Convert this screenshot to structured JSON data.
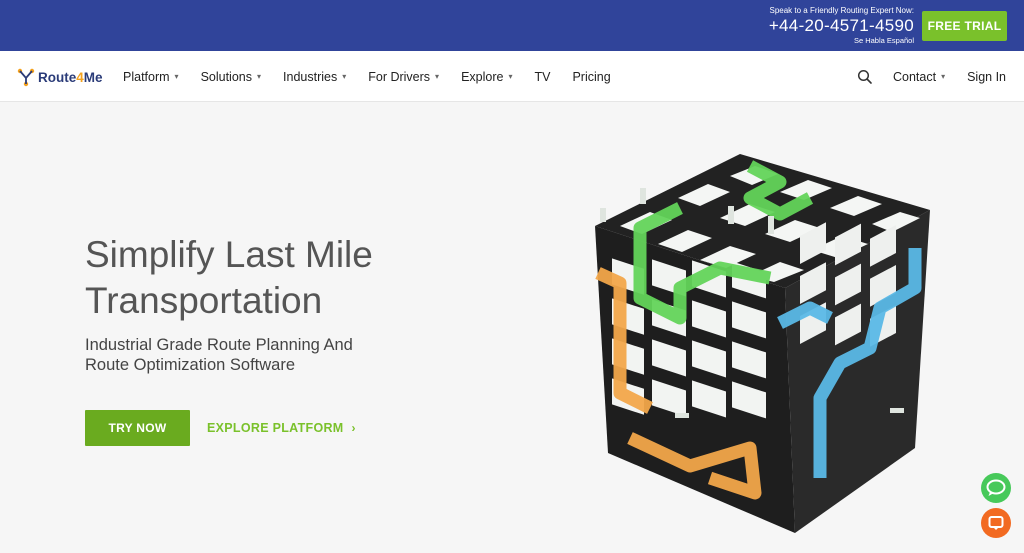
{
  "topbar": {
    "speak": "Speak to a Friendly Routing Expert Now:",
    "phone": "+44-20-4571-4590",
    "espanol": "Se Habla Español",
    "trial_label": "FREE TRIAL"
  },
  "nav": {
    "logo_a": "Route",
    "logo_b": "4",
    "logo_c": "Me",
    "items": [
      {
        "label": "Platform",
        "dropdown": true
      },
      {
        "label": "Solutions",
        "dropdown": true
      },
      {
        "label": "Industries",
        "dropdown": true
      },
      {
        "label": "For Drivers",
        "dropdown": true
      },
      {
        "label": "Explore",
        "dropdown": true
      },
      {
        "label": "TV",
        "dropdown": false
      },
      {
        "label": "Pricing",
        "dropdown": false
      }
    ],
    "contact": "Contact",
    "signin": "Sign In"
  },
  "hero": {
    "title_line1": "Simplify Last Mile",
    "title_line2": "Transportation",
    "sub_line1": "Industrial Grade Route Planning And",
    "sub_line2": "Route Optimization Software",
    "try_label": "TRY NOW",
    "explore_label": "EXPLORE PLATFORM",
    "explore_arrow": "›"
  },
  "colors": {
    "topbar": "#30449a",
    "accent_green": "#7ac12b",
    "chat_green": "#47c95a",
    "support_orange": "#f26a21",
    "cube_green": "#63d45a",
    "cube_orange": "#f2a74a",
    "cube_blue": "#5ab8e6"
  },
  "icons": {
    "search": "search-icon",
    "chevron": "chevron-down-icon",
    "chat": "chat-bubble-icon",
    "support": "support-chat-icon"
  }
}
